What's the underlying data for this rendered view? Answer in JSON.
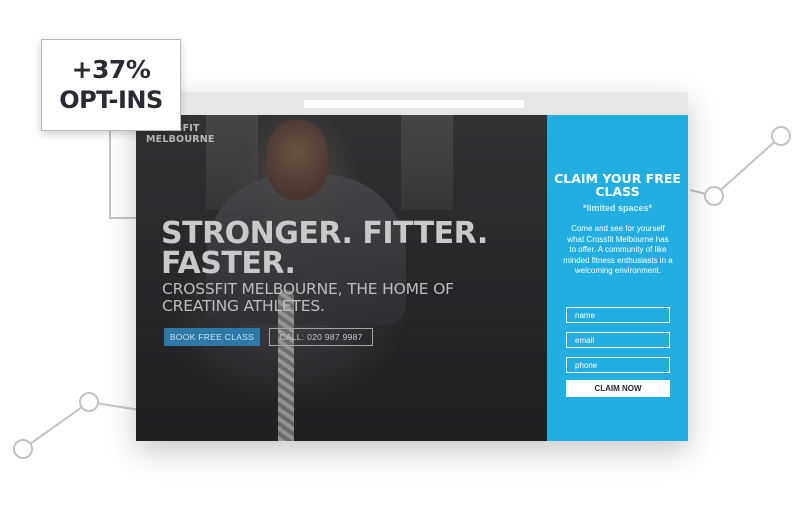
{
  "badge": {
    "percent": "+37%",
    "label": "OPT-INS"
  },
  "hero": {
    "logo_line1": "CROSSFIT",
    "logo_line2": "MELBOURNE",
    "headline": "STRONGER. FITTER. FASTER.",
    "subline": "CROSSFIT MELBOURNE, THE HOME OF CREATING ATHLETES.",
    "book_button": "BOOK FREE CLASS",
    "call_button": "CALL: 020 987 9987"
  },
  "form": {
    "title": "CLAIM YOUR FREE CLASS",
    "subtitle": "*limited spaces*",
    "description": "Come and see for yourself what Crossfit Melbourne has to offer. A community of like minded fitness enthusiasts in a welcoming environment.",
    "name_placeholder": "name",
    "email_placeholder": "email",
    "phone_placeholder": "phone",
    "submit": "CLAIM NOW"
  },
  "colors": {
    "panel": "#22aee0",
    "book_button": "#2d78a8",
    "badge_text": "#2a2a35",
    "graph_line": "#c3c3c3"
  }
}
